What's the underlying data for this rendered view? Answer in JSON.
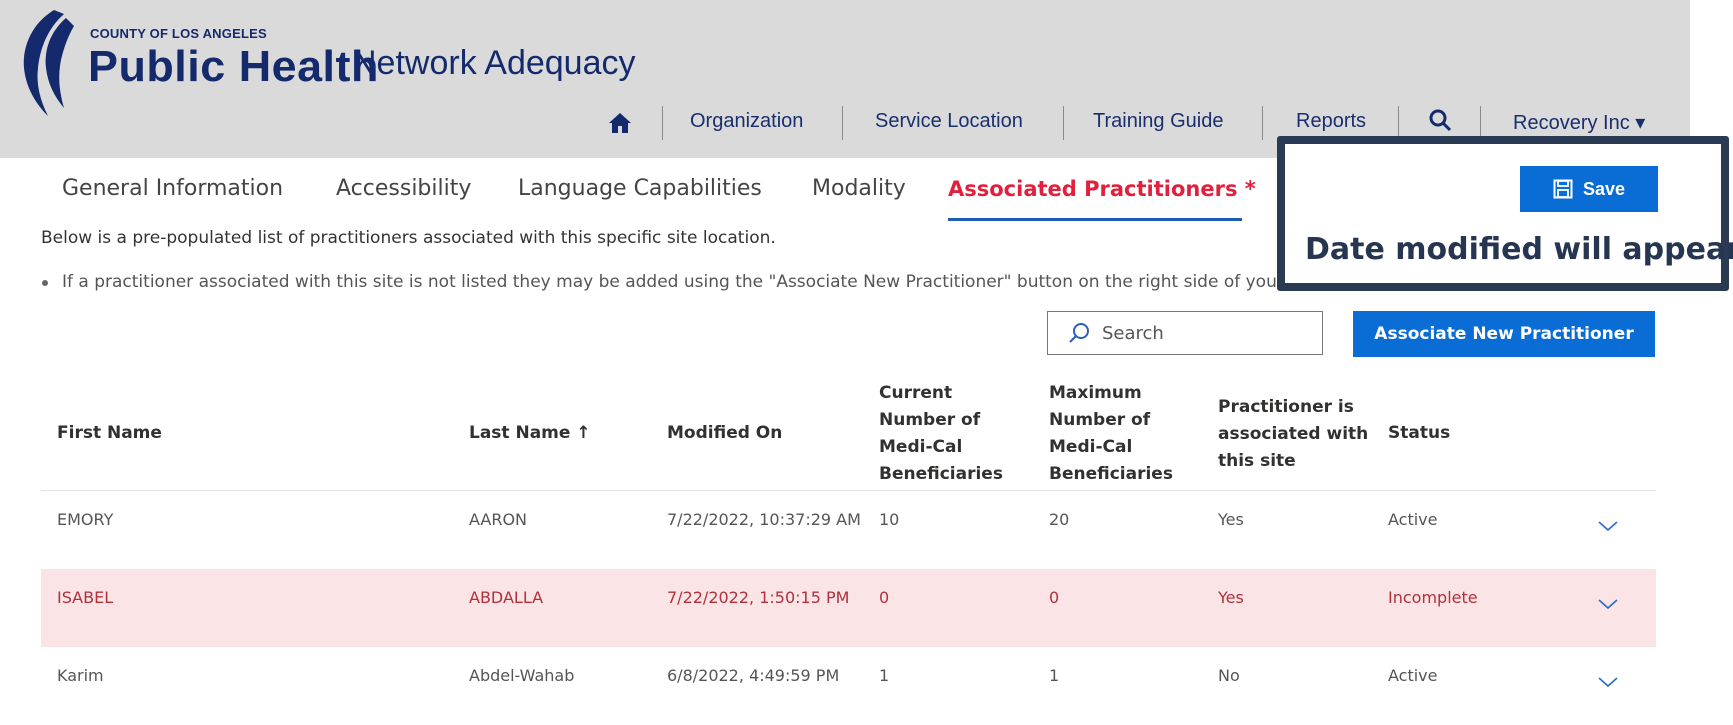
{
  "header": {
    "org_line": "COUNTY OF LOS ANGELES",
    "org_name": "Public Health",
    "app_title": "Network Adequacy",
    "nav": {
      "organization": "Organization",
      "service_location": "Service Location",
      "training_guide": "Training Guide",
      "reports": "Reports",
      "account": "Recovery Inc ▾"
    }
  },
  "tabs": {
    "general": "General Information",
    "accessibility": "Accessibility",
    "language": "Language Capabilities",
    "modality": "Modality",
    "associated": "Associated Practitioners *"
  },
  "intro_text": "Below is a pre-populated list of practitioners associated with this specific site location.",
  "bullet_text": "If a practitioner associated with this site is not listed they may be added using the \"Associate New Practitioner\" button on the right side of your screen.",
  "toolbar": {
    "save_label": "Save",
    "search_placeholder": "Search",
    "associate_label": "Associate New Practitioner"
  },
  "callout_text": "Date modified will appear",
  "table": {
    "columns": {
      "first_name": "First Name",
      "last_name": "Last Name ↑",
      "modified_on": "Modified On",
      "current": [
        "Current",
        "Number of",
        "Medi-Cal",
        "Beneficiaries"
      ],
      "maximum": [
        "Maximum",
        "Number of",
        "Medi-Cal",
        "Beneficiaries"
      ],
      "associated": [
        "Practitioner is",
        "associated with",
        "this site"
      ],
      "status": "Status"
    },
    "rows": [
      {
        "first": "EMORY",
        "last": "AARON",
        "modified": "7/22/2022, 10:37:29 AM",
        "current": "10",
        "maximum": "20",
        "associated": "Yes",
        "status": "Active"
      },
      {
        "first": "ISABEL",
        "last": "ABDALLA",
        "modified": "7/22/2022, 1:50:15 PM",
        "current": "0",
        "maximum": "0",
        "associated": "Yes",
        "status": "Incomplete"
      },
      {
        "first": "Karim",
        "last": "Abdel-Wahab",
        "modified": "6/8/2022, 4:49:59 PM",
        "current": "1",
        "maximum": "1",
        "associated": "No",
        "status": "Active"
      }
    ]
  },
  "colors": {
    "brand_navy": "#142a6c",
    "primary_blue": "#0a6dd6",
    "active_tab_red": "#e0203c",
    "incomplete_row_bg": "#fbe4e6",
    "callout_border": "#2a3a53"
  }
}
